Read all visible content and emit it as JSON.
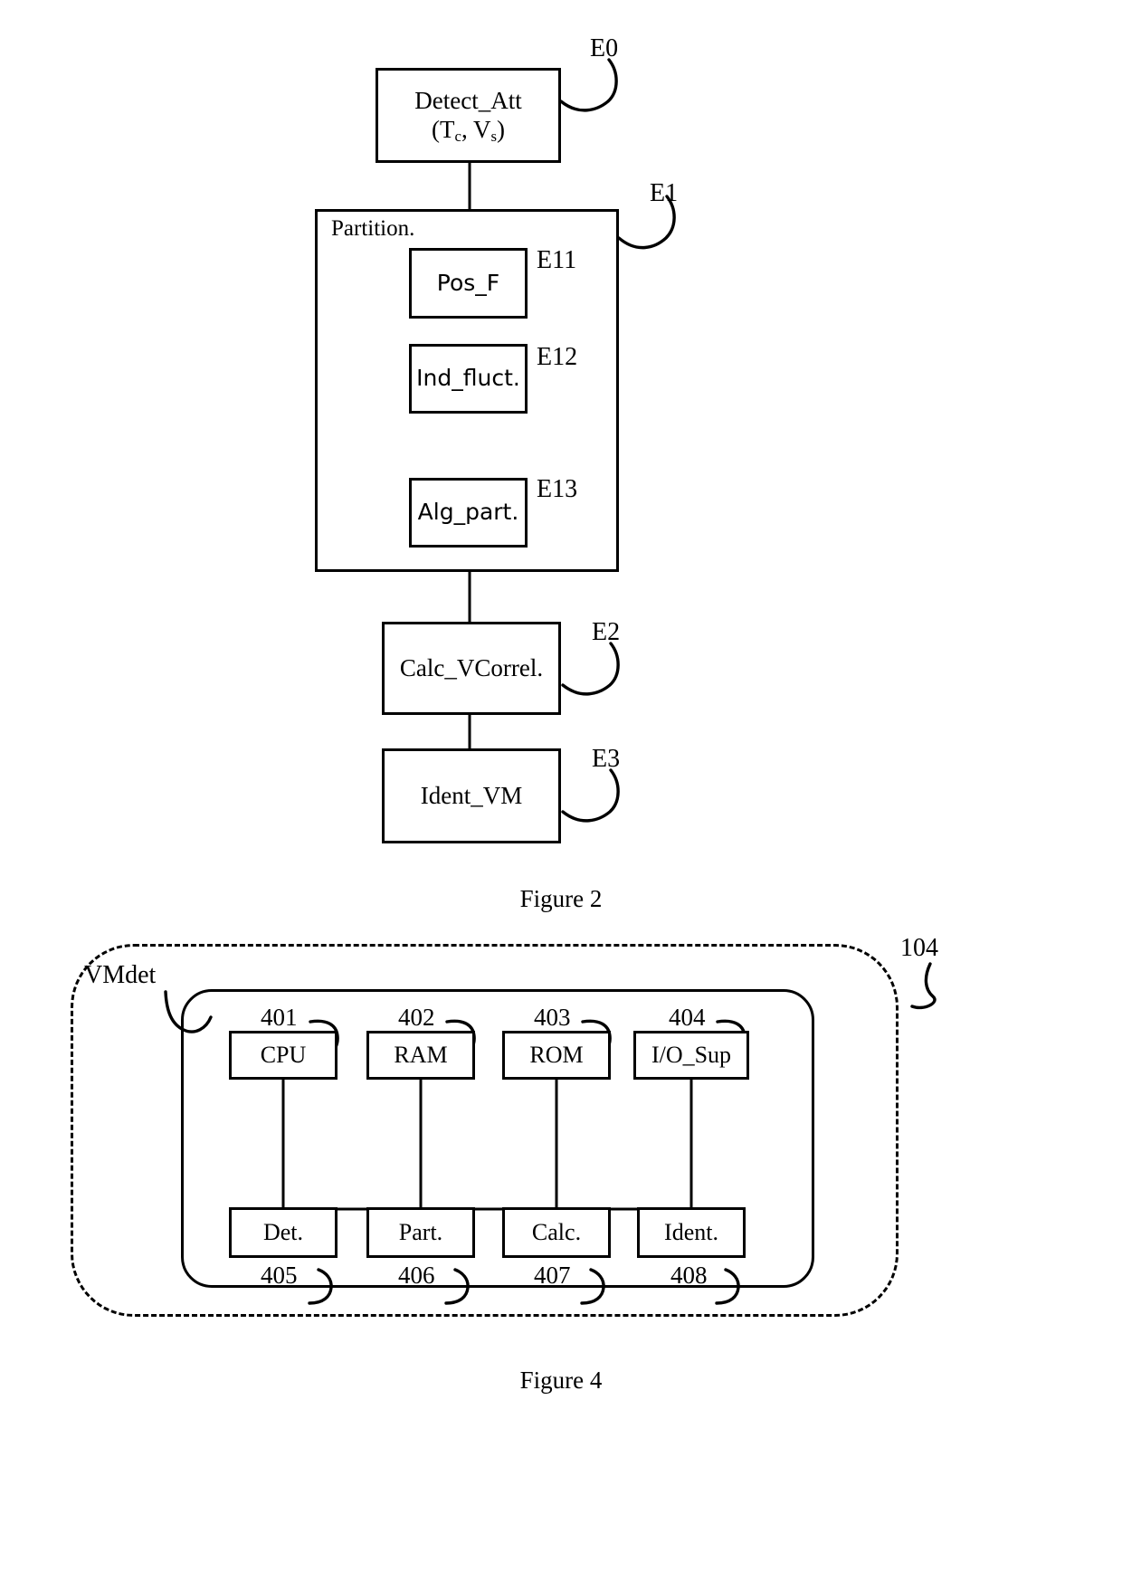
{
  "figure2": {
    "caption": "Figure 2",
    "boxes": {
      "detect_att": {
        "line1": "Detect_Att",
        "line2_prefix": "(T",
        "line2_sub1": "c",
        "line2_mid": ", V",
        "line2_sub2": "s",
        "line2_suffix": ")"
      },
      "partition_label": "Partition.",
      "pos_f": "Pos_F",
      "ind_fluct": "Ind_fluct.",
      "alg_part": "Alg_part.",
      "calc_vcorrel": "Calc_VCorrel.",
      "ident_vm": "Ident_VM"
    },
    "refs": {
      "e0": "E0",
      "e1": "E1",
      "e11": "E11",
      "e12": "E12",
      "e13": "E13",
      "e2": "E2",
      "e3": "E3"
    }
  },
  "figure4": {
    "caption": "Figure 4",
    "outer_ref": "104",
    "inner_label": "VMdet",
    "top_row": [
      {
        "label": "CPU",
        "ref": "401"
      },
      {
        "label": "RAM",
        "ref": "402"
      },
      {
        "label": "ROM",
        "ref": "403"
      },
      {
        "label": "I/O_Sup",
        "ref": "404"
      }
    ],
    "bottom_row": [
      {
        "label": "Det.",
        "ref": "405"
      },
      {
        "label": "Part.",
        "ref": "406"
      },
      {
        "label": "Calc.",
        "ref": "407"
      },
      {
        "label": "Ident.",
        "ref": "408"
      }
    ]
  },
  "colors": {
    "stroke": "#000000",
    "background": "#ffffff"
  }
}
